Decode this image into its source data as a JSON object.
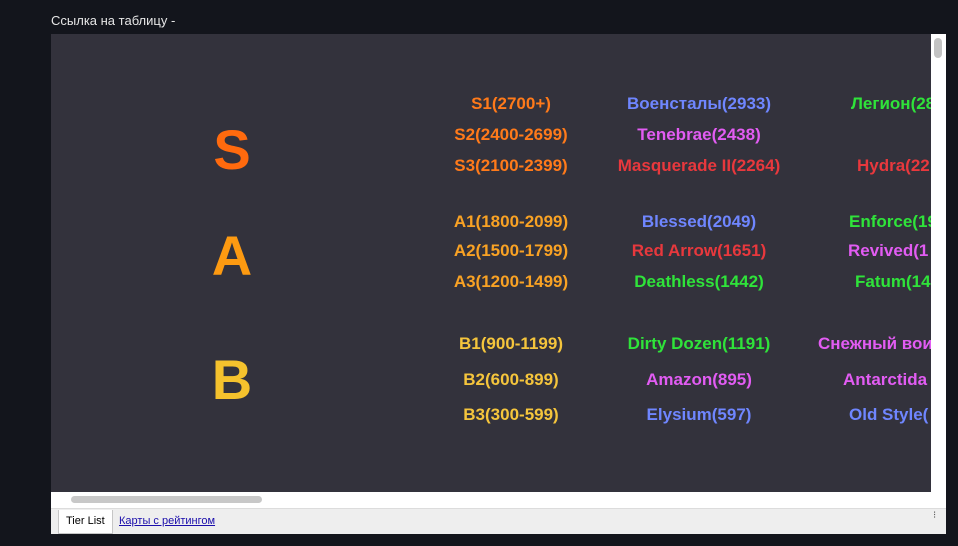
{
  "header": {
    "label": "Ссылка на таблицу -"
  },
  "colors": {
    "background": "#13151c",
    "sheet_background": "#33323c",
    "tier_s": "#ff6a0e",
    "tier_a": "#fd9a11",
    "tier_b": "#f5c22d",
    "range_s": "#ff7a1a",
    "range_a": "#f9a224",
    "range_b": "#f5c53c",
    "blue": "#6f86ff",
    "green": "#2fe33a",
    "magenta": "#e25cf3",
    "red": "#e8383d"
  },
  "tiers": [
    {
      "letter": "S",
      "color": "#ff6a0e",
      "rows": [
        {
          "range": "S1(2700+)",
          "range_color": "#ff7a1a",
          "clans": [
            {
              "text": "Военсталы(2933)",
              "color": "#6f86ff"
            },
            {
              "text": "Легион(28",
              "color": "#2fe33a"
            }
          ]
        },
        {
          "range": "S2(2400-2699)",
          "range_color": "#ff7a1a",
          "clans": [
            {
              "text": "Tenebrae(2438)",
              "color": "#e25cf3"
            }
          ]
        },
        {
          "range": "S3(2100-2399)",
          "range_color": "#ff7a1a",
          "clans": [
            {
              "text": "Masquerade II(2264)",
              "color": "#e8383d"
            },
            {
              "text": "Hydra(22",
              "color": "#e8383d"
            }
          ]
        }
      ]
    },
    {
      "letter": "A",
      "color": "#fd9a11",
      "rows": [
        {
          "range": "A1(1800-2099)",
          "range_color": "#f9a224",
          "clans": [
            {
              "text": "Blessed(2049)",
              "color": "#6f86ff"
            },
            {
              "text": "Enforce(19",
              "color": "#2fe33a"
            }
          ]
        },
        {
          "range": "A2(1500-1799)",
          "range_color": "#f9a224",
          "clans": [
            {
              "text": "Red Arrow(1651)",
              "color": "#e8383d"
            },
            {
              "text": "Revived(1",
              "color": "#e25cf3"
            }
          ]
        },
        {
          "range": "A3(1200-1499)",
          "range_color": "#f9a224",
          "clans": [
            {
              "text": "Deathless(1442)",
              "color": "#2fe33a"
            },
            {
              "text": "Fatum(14",
              "color": "#2fe33a"
            }
          ]
        }
      ]
    },
    {
      "letter": "B",
      "color": "#f5c22d",
      "rows": [
        {
          "range": "B1(900-1199)",
          "range_color": "#f5c53c",
          "clans": [
            {
              "text": "Dirty Dozen(1191)",
              "color": "#2fe33a"
            },
            {
              "text": "Снежный вои",
              "color": "#e25cf3"
            }
          ]
        },
        {
          "range": "B2(600-899)",
          "range_color": "#f5c53c",
          "clans": [
            {
              "text": "Amazon(895)",
              "color": "#e25cf3"
            },
            {
              "text": "Antarctida",
              "color": "#e25cf3"
            }
          ]
        },
        {
          "range": "B3(300-599)",
          "range_color": "#f5c53c",
          "clans": [
            {
              "text": "Elysium(597)",
              "color": "#6f86ff"
            },
            {
              "text": "Old Style(",
              "color": "#6f86ff"
            }
          ]
        }
      ]
    }
  ],
  "tabs": [
    {
      "label": "Tier List",
      "active": true
    },
    {
      "label": "Карты с рейтингом",
      "active": false
    }
  ]
}
